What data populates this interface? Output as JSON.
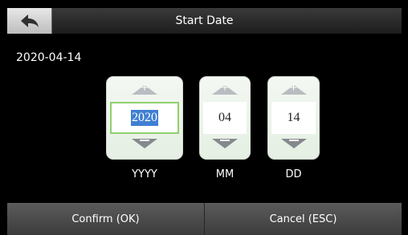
{
  "header": {
    "title": "Start Date",
    "back_icon": "back-arrow-icon"
  },
  "summary": {
    "date_text": "2020-04-14"
  },
  "spinners": [
    {
      "label": "YYYY",
      "value": "2020",
      "selected": true,
      "up_icon": "chevron-up-plus-icon",
      "down_icon": "chevron-down-minus-icon"
    },
    {
      "label": "MM",
      "value": "04",
      "selected": false,
      "up_icon": "chevron-up-plus-icon",
      "down_icon": "chevron-down-minus-icon"
    },
    {
      "label": "DD",
      "value": "14",
      "selected": false,
      "up_icon": "chevron-up-plus-icon",
      "down_icon": "chevron-down-minus-icon"
    }
  ],
  "footer": {
    "confirm_label": "Confirm (OK)",
    "cancel_label": "Cancel (ESC)"
  },
  "colors": {
    "background": "#000000",
    "header": "#2a2a2a",
    "selection": "#3f7fd2",
    "selected_border": "#8fd16e",
    "footer_button": "#4a4a4a"
  }
}
